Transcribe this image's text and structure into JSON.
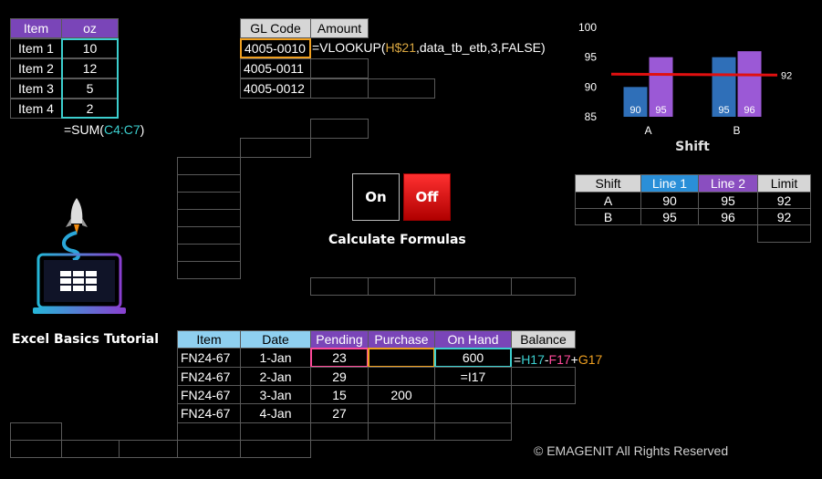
{
  "item_table": {
    "headers": [
      "Item",
      "oz"
    ],
    "rows": [
      [
        "Item 1",
        "10"
      ],
      [
        "Item 2",
        "12"
      ],
      [
        "Item 3",
        "5"
      ],
      [
        "Item 4",
        "2"
      ]
    ],
    "formula_prefix": "=SUM(",
    "formula_ref": "C4:C7",
    "formula_suffix": ")"
  },
  "gl_table": {
    "headers": [
      "GL Code",
      "Amount"
    ],
    "codes": [
      "4005-0010",
      "4005-0011",
      "4005-0012"
    ],
    "formula_prefix": "=VLOOKUP(",
    "formula_ref": "H$21",
    "formula_suffix": ",data_tb_etb,3,FALSE)"
  },
  "chart_data": {
    "type": "bar",
    "title": "Shift",
    "categories": [
      "A",
      "B"
    ],
    "ylim": [
      85,
      100
    ],
    "yticks": [
      85,
      90,
      95,
      100
    ],
    "series": [
      {
        "name": "Line 1",
        "values": [
          90,
          95
        ],
        "color": "#2f6fb8"
      },
      {
        "name": "Line 2",
        "values": [
          95,
          96
        ],
        "color": "#9b59d6"
      }
    ],
    "limit": {
      "name": "Limit",
      "values": [
        92,
        92
      ],
      "label": "92",
      "color": "#e01010"
    }
  },
  "shift_table": {
    "headers": [
      "Shift",
      "Line 1",
      "Line 2",
      "Limit"
    ],
    "rows": [
      [
        "A",
        "90",
        "95",
        "92"
      ],
      [
        "B",
        "95",
        "96",
        "92"
      ]
    ]
  },
  "buttons": {
    "on": "On",
    "off": "Off",
    "caption": "Calculate Formulas"
  },
  "brand": {
    "title": "Excel Basics Tutorial",
    "copyright": "© EMAGENIT All Rights Reserved"
  },
  "inventory_table": {
    "headers": [
      "Item",
      "Date",
      "Pending",
      "Purchase",
      "On Hand",
      "Balance"
    ],
    "rows": [
      [
        "FN24-67",
        "1-Jan",
        "23",
        "",
        "600"
      ],
      [
        "FN24-67",
        "2-Jan",
        "29",
        "",
        ""
      ],
      [
        "FN24-67",
        "3-Jan",
        "15",
        "200",
        ""
      ],
      [
        "FN24-67",
        "4-Jan",
        "27",
        "",
        ""
      ]
    ],
    "onhand_formula": "=I17",
    "balance_formula": {
      "eq": "=",
      "a": "H17",
      "minus": "-",
      "b": "F17",
      "plus": "+",
      "c": "G17"
    }
  },
  "colors": {
    "accent_purple": "#7a45b8",
    "accent_teal": "#3ccfcf",
    "off_red": "#e01010"
  }
}
